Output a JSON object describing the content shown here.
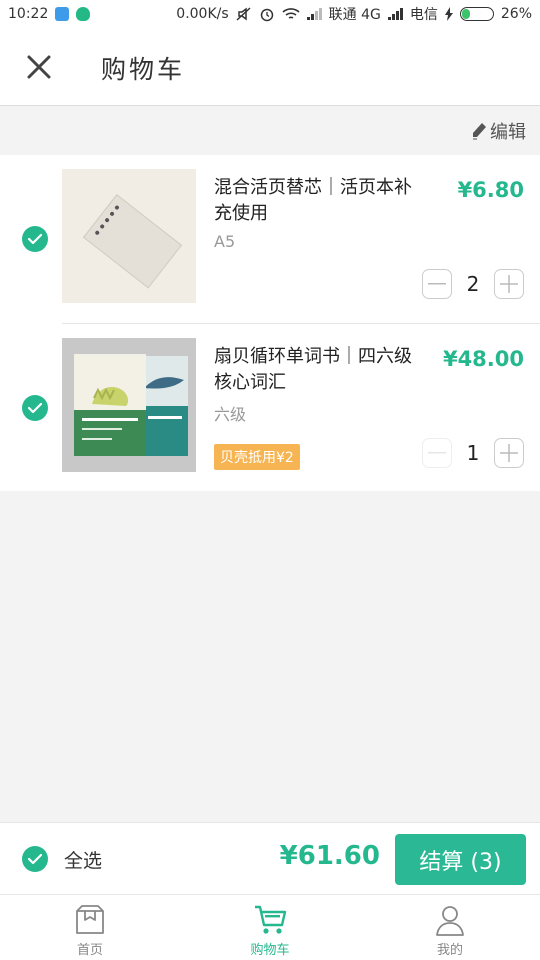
{
  "status_bar": {
    "time": "10:22",
    "speed": "0.00K/s",
    "carrier1": "联通 4G",
    "carrier2": "电信",
    "battery": "26%",
    "battery_level": 0.26
  },
  "header": {
    "title": "购物车"
  },
  "edit": {
    "label": "编辑"
  },
  "items": [
    {
      "title": "混合活页替芯｜活页本补充使用",
      "spec": "A5",
      "price": "¥6.80",
      "qty": "2",
      "badge": ""
    },
    {
      "title": "扇贝循环单词书｜四六级核心词汇",
      "spec": "六级",
      "price": "¥48.00",
      "qty": "1",
      "badge": "贝壳抵用¥2"
    }
  ],
  "checkout": {
    "select_all": "全选",
    "total": "¥61.60",
    "pay_button": "结算 (3)"
  },
  "tabs": [
    {
      "label": "首页",
      "icon": "home-box-icon",
      "active": false
    },
    {
      "label": "购物车",
      "icon": "cart-icon",
      "active": true
    },
    {
      "label": "我的",
      "icon": "user-icon",
      "active": false
    }
  ],
  "colors": {
    "accent": "#25b88e",
    "badge": "#f7b452",
    "page_bg": "#f3f3f4"
  }
}
